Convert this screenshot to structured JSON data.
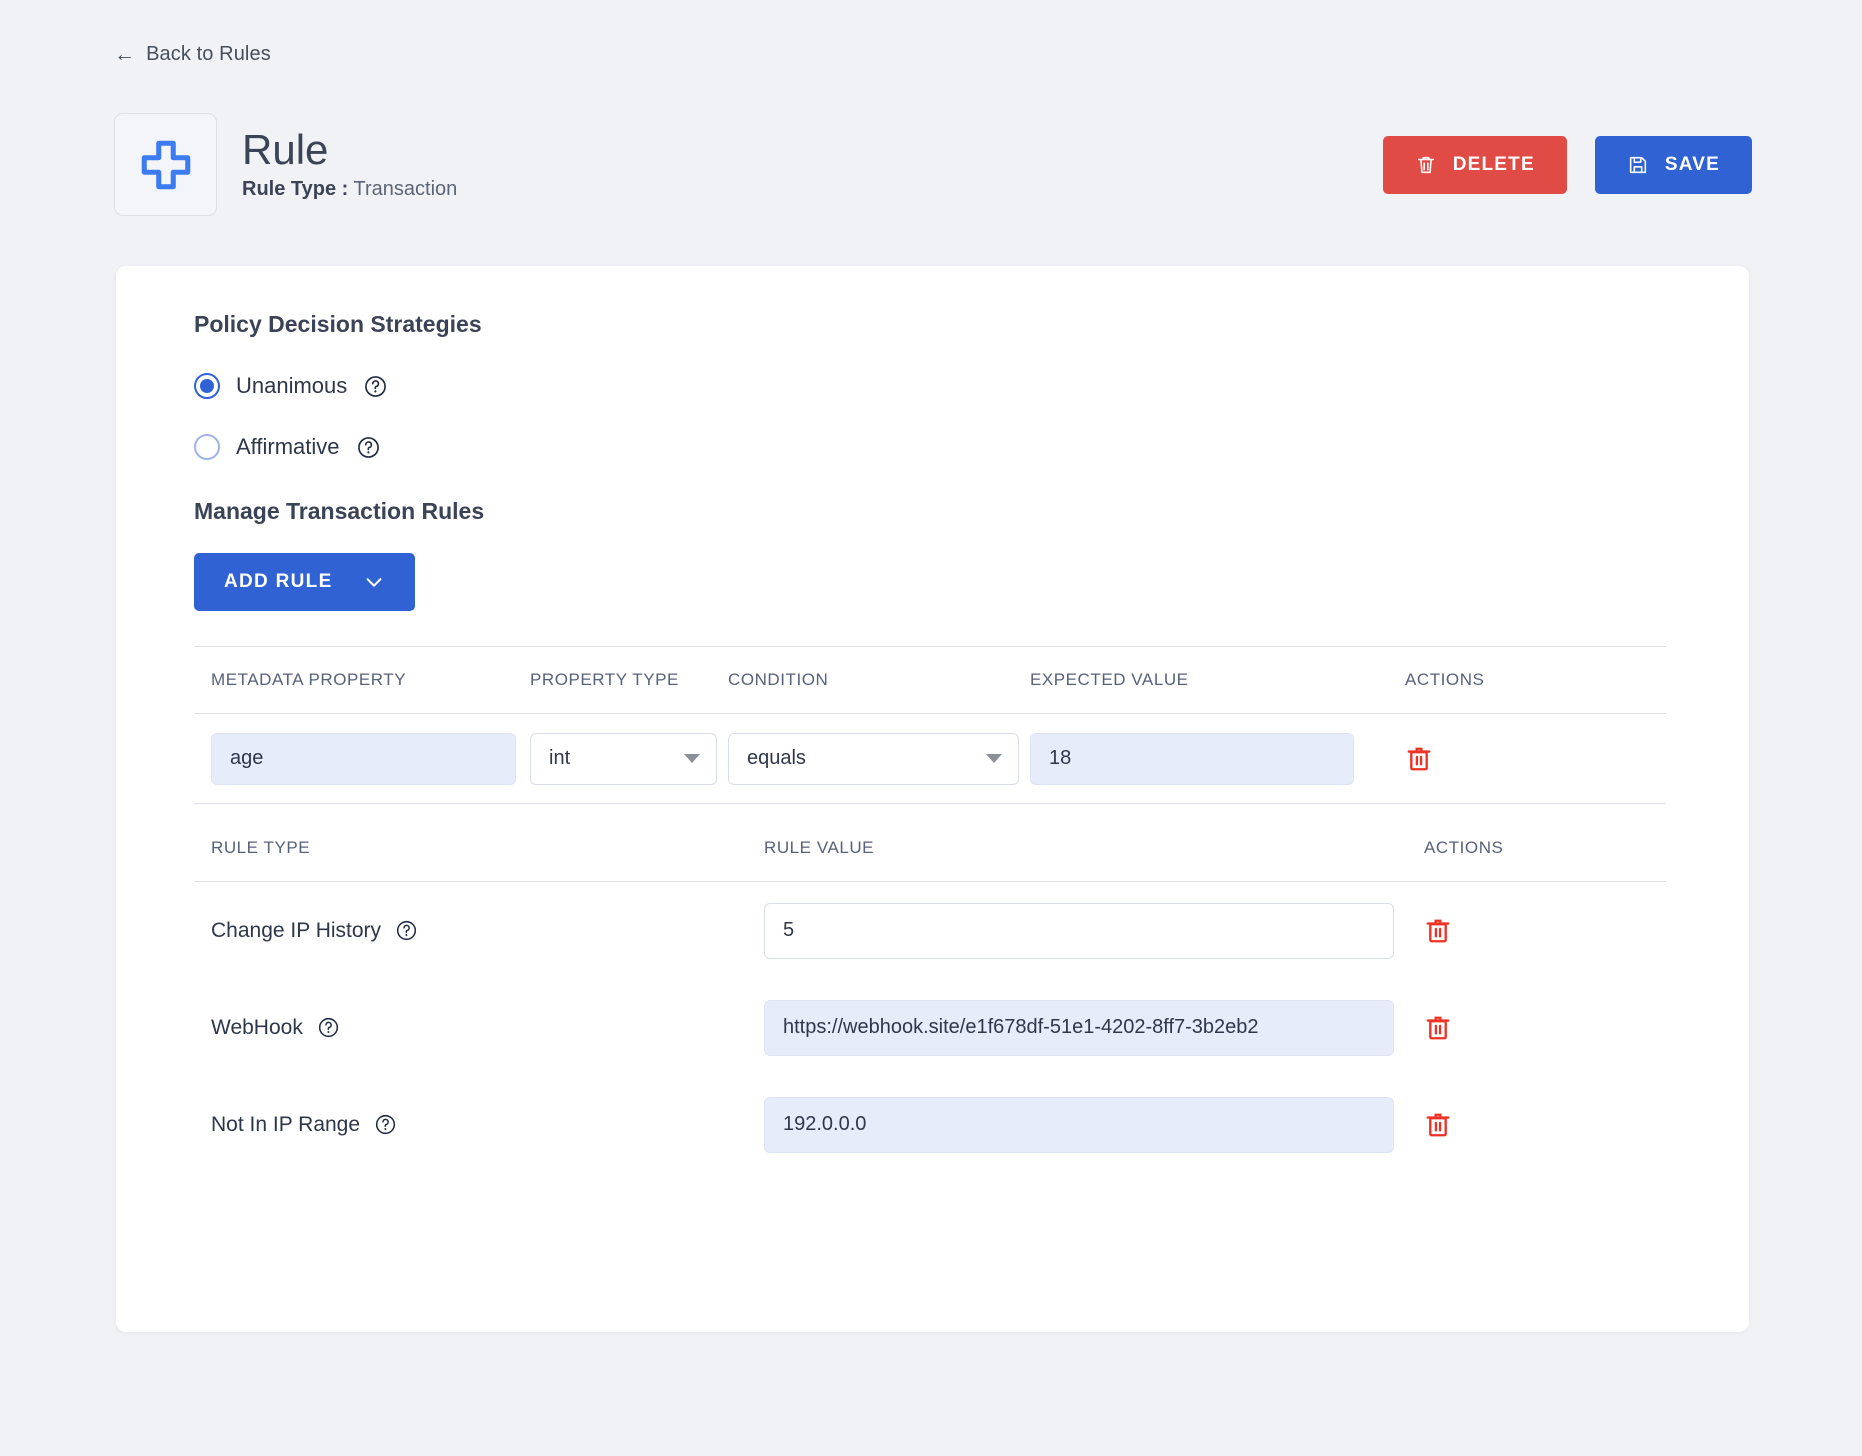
{
  "nav": {
    "back_label": "Back to Rules",
    "back_icon": "arrow-left-icon"
  },
  "header": {
    "icon": "plus-cross-icon",
    "title": "Rule",
    "rule_type_label": "Rule Type :",
    "rule_type_value": "Transaction",
    "delete_label": "DELETE",
    "delete_icon": "trash-icon",
    "save_label": "SAVE",
    "save_icon": "floppy-disk-icon",
    "delete_color": "#e04b45",
    "save_color": "#3062d4"
  },
  "policy": {
    "title": "Policy Decision Strategies",
    "options": [
      {
        "label": "Unanimous",
        "selected": true,
        "help_icon": "help-circle-icon"
      },
      {
        "label": "Affirmative",
        "selected": false,
        "help_icon": "help-circle-icon"
      }
    ]
  },
  "manage": {
    "title": "Manage Transaction Rules",
    "add_rule_label": "ADD RULE",
    "add_rule_caret": "chevron-down-icon"
  },
  "metadata_table": {
    "headers": [
      "METADATA PROPERTY",
      "PROPERTY TYPE",
      "CONDITION",
      "EXPECTED VALUE",
      "ACTIONS"
    ],
    "rows": [
      {
        "metadata_property": "age",
        "property_type": "int",
        "condition": "equals",
        "expected_value": "18",
        "delete_icon": "trash-icon"
      }
    ]
  },
  "rules_table": {
    "headers": [
      "RULE TYPE",
      "RULE VALUE",
      "ACTIONS"
    ],
    "rows": [
      {
        "rule_type": "Change IP History",
        "help_icon": "help-circle-icon",
        "rule_value": "5",
        "value_style": "white",
        "delete_icon": "trash-icon"
      },
      {
        "rule_type": "WebHook",
        "help_icon": "help-circle-icon",
        "rule_value": "https://webhook.site/e1f678df-51e1-4202-8ff7-3b2eb2",
        "value_style": "filled",
        "delete_icon": "trash-icon"
      },
      {
        "rule_type": "Not In IP Range",
        "help_icon": "help-circle-icon",
        "rule_value": "192.0.0.0",
        "value_style": "filled",
        "delete_icon": "trash-icon"
      }
    ]
  }
}
